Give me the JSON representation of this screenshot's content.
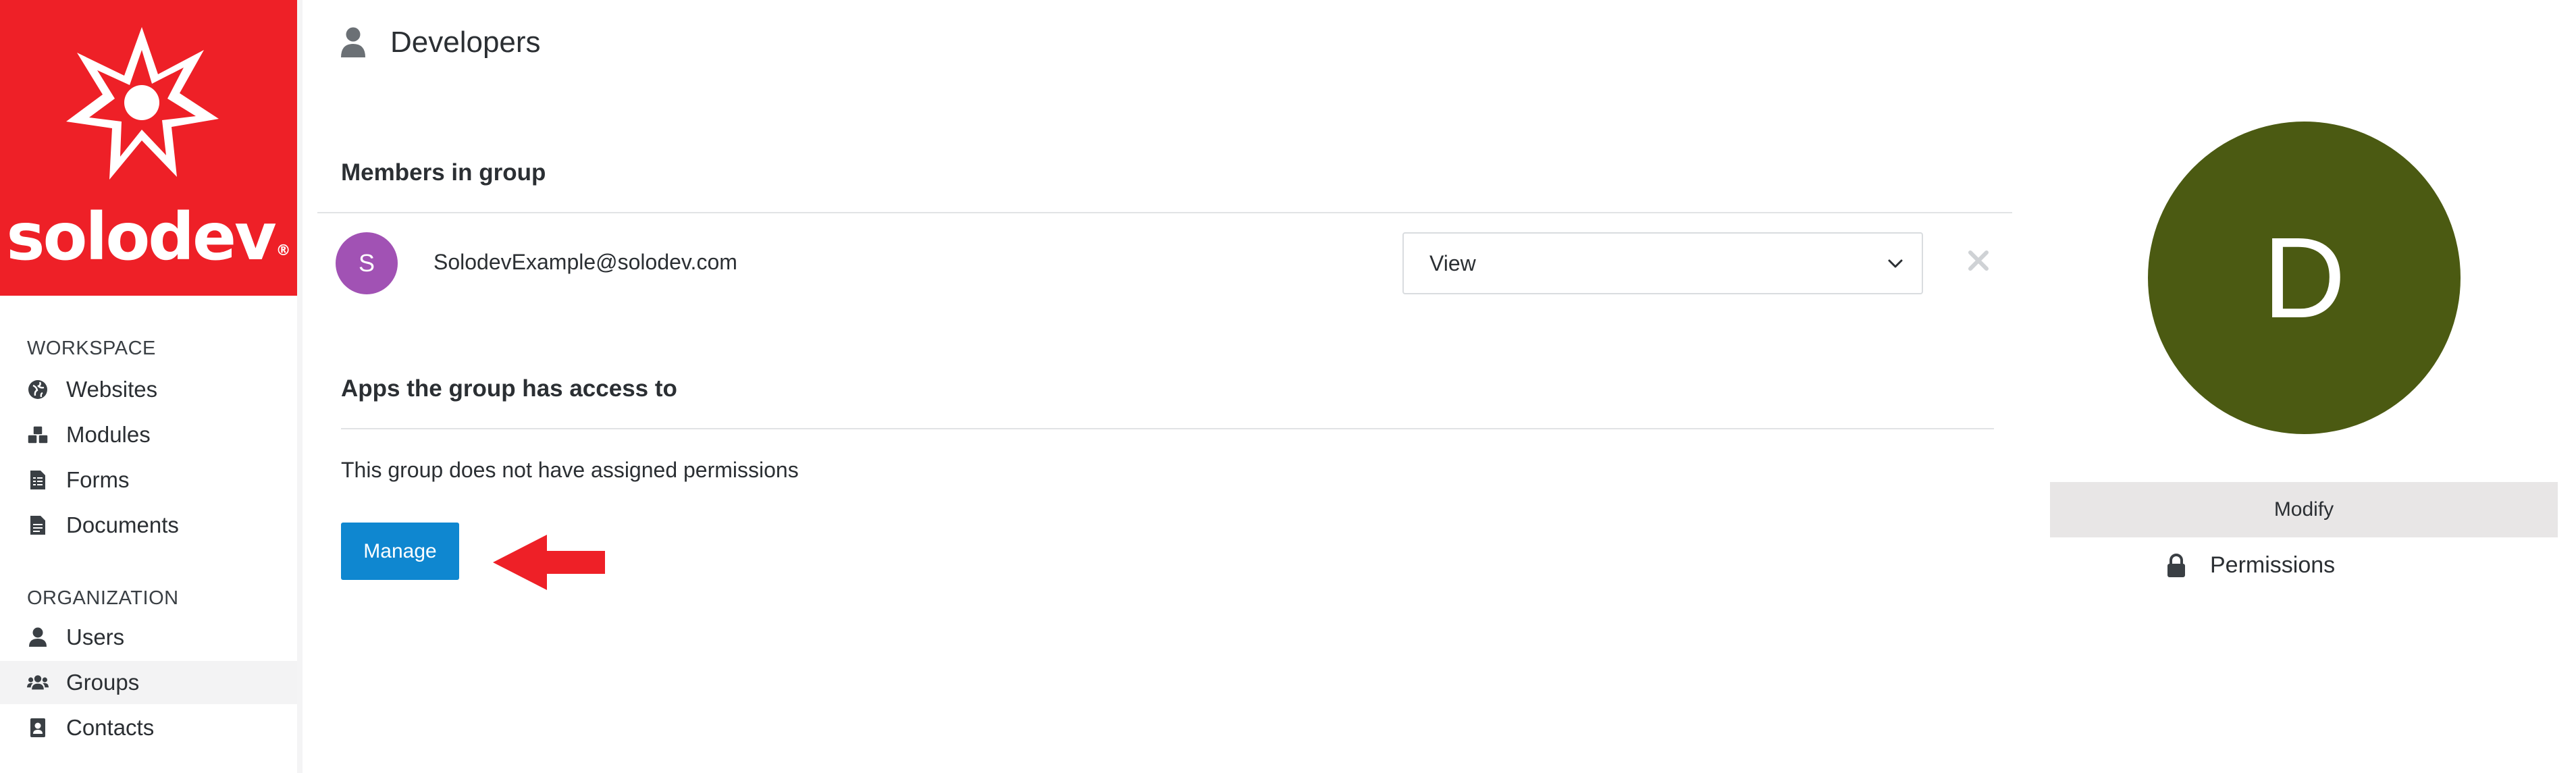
{
  "brand": {
    "name": "solodev",
    "mark": "®",
    "color": "#ee2027"
  },
  "sidebar": {
    "workspace_label": "WORKSPACE",
    "workspace_items": [
      {
        "label": "Websites",
        "icon": "globe-icon"
      },
      {
        "label": "Modules",
        "icon": "cubes-icon"
      },
      {
        "label": "Forms",
        "icon": "form-icon"
      },
      {
        "label": "Documents",
        "icon": "document-icon"
      }
    ],
    "organization_label": "ORGANIZATION",
    "organization_items": [
      {
        "label": "Users",
        "icon": "user-icon"
      },
      {
        "label": "Groups",
        "icon": "users-icon",
        "active": true
      },
      {
        "label": "Contacts",
        "icon": "contact-card-icon"
      }
    ]
  },
  "header": {
    "title": "Developers",
    "icon": "user-icon"
  },
  "members": {
    "title": "Members in group",
    "rows": [
      {
        "initial": "S",
        "email": "SolodevExample@solodev.com",
        "role": "View",
        "avatar_color": "#a152b4"
      }
    ]
  },
  "apps": {
    "title": "Apps the group has access to",
    "empty_text": "This group does not have assigned permissions",
    "manage_label": "Manage",
    "manage_color": "#0f87d0"
  },
  "group_profile": {
    "initial": "D",
    "avatar_color": "#4b5a12",
    "modify_label": "Modify",
    "permissions_label": "Permissions"
  }
}
